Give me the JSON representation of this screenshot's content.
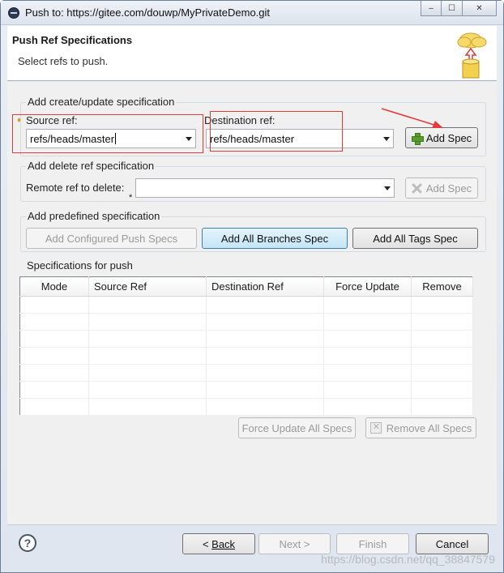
{
  "window": {
    "title": "Push to: https://gitee.com/douwp/MyPrivateDemo.git",
    "controls": {
      "minimize": "‒",
      "maximize": "☐",
      "close": "✕"
    }
  },
  "header": {
    "title": "Push Ref Specifications",
    "subtitle": "Select refs to push."
  },
  "create_group": {
    "label": "Add create/update specification",
    "source_label": "Source ref:",
    "source_value": "refs/heads/master",
    "destination_label": "Destination ref:",
    "destination_value": "refs/heads/master",
    "add_button": "Add Spec"
  },
  "delete_group": {
    "label": "Add delete ref specification",
    "remote_label": "Remote ref to delete:",
    "remote_value": "",
    "required_marker": "*",
    "add_button": "Add Spec"
  },
  "predefined_group": {
    "label": "Add predefined specification",
    "configured_button": "Add Configured Push Specs",
    "all_branches_button": "Add All Branches Spec",
    "all_tags_button": "Add All Tags Spec"
  },
  "specs_group": {
    "label": "Specifications for push",
    "columns": [
      "Mode",
      "Source Ref",
      "Destination Ref",
      "Force Update",
      "Remove"
    ],
    "rows": [],
    "force_update_all": "Force Update All Specs",
    "remove_all": "Remove All Specs"
  },
  "footer": {
    "back": "Back",
    "back_prefix": "< ",
    "next": "Next >",
    "finish": "Finish",
    "cancel": "Cancel",
    "help": "?"
  },
  "watermark": "https://blog.csdn.net/qq_38847579",
  "colors": {
    "annotation_red": "#e23b3b",
    "selected_button": "#c4e5f6"
  }
}
